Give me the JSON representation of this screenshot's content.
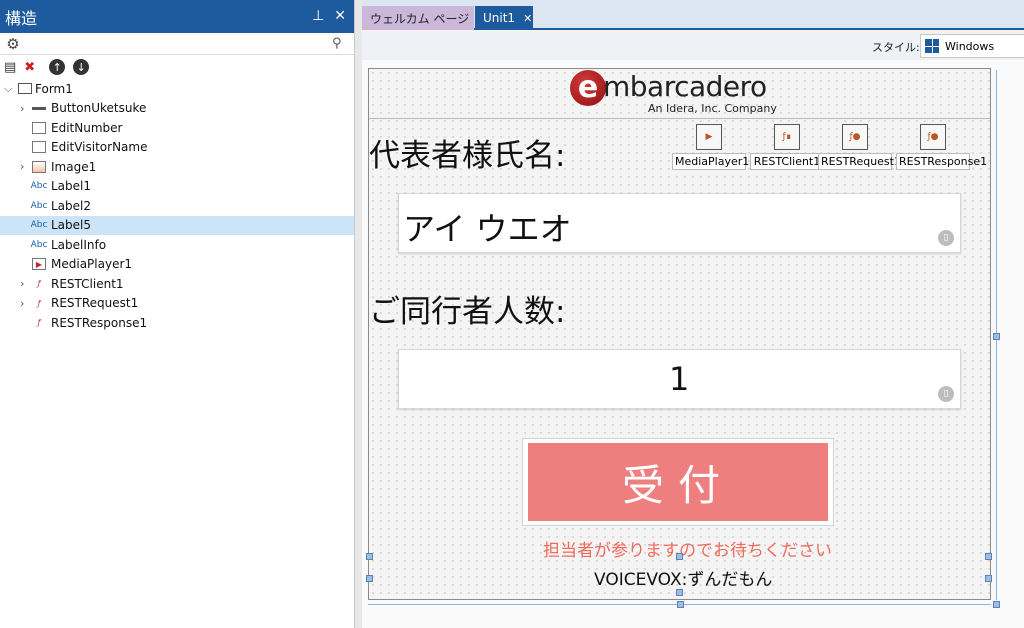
{
  "structure_panel": {
    "title": "構造",
    "pin_icon": "pin-icon",
    "close_icon": "close-icon",
    "search": {
      "value": "",
      "placeholder": ""
    },
    "tree": [
      {
        "label": "Form1",
        "level": 0,
        "expanded": true
      },
      {
        "label": "ButtonUketsuke",
        "level": 1,
        "expandable": true,
        "icon": "button-icon"
      },
      {
        "label": "EditNumber",
        "level": 1,
        "icon": "edit-icon"
      },
      {
        "label": "EditVisitorName",
        "level": 1,
        "icon": "edit-icon"
      },
      {
        "label": "Image1",
        "level": 1,
        "expandable": true,
        "icon": "image-icon"
      },
      {
        "label": "Label1",
        "level": 1,
        "icon": "label-icon"
      },
      {
        "label": "Label2",
        "level": 1,
        "icon": "label-icon"
      },
      {
        "label": "Label5",
        "level": 1,
        "icon": "label-icon",
        "selected": true
      },
      {
        "label": "LabelInfo",
        "level": 1,
        "icon": "label-icon"
      },
      {
        "label": "MediaPlayer1",
        "level": 1,
        "icon": "mediaplayer-icon"
      },
      {
        "label": "RESTClient1",
        "level": 1,
        "expandable": true,
        "icon": "rest-icon"
      },
      {
        "label": "RESTRequest1",
        "level": 1,
        "expandable": true,
        "icon": "rest-icon"
      },
      {
        "label": "RESTResponse1",
        "level": 1,
        "icon": "rest-icon"
      }
    ],
    "label_icon_text": "Abc"
  },
  "tabs": [
    {
      "label": "ウェルカム ページ",
      "active": false
    },
    {
      "label": "Unit1",
      "active": true
    }
  ],
  "style_bar": {
    "label": "スタイル:",
    "value": "Windows"
  },
  "form": {
    "logo_text": "mbarcadero",
    "logo_tagline": "An Idera, Inc. Company",
    "label_name": "代表者様氏名:",
    "edit_name_value": "アイ ウエオ",
    "label_companions": "ご同行者人数:",
    "edit_number_value": "1",
    "components": [
      "MediaPlayer1",
      "RESTClient1",
      "RESTRequest1",
      "RESTResponse1"
    ],
    "button_label": "受付",
    "info_text": "担当者が参りますのでお待ちください",
    "voicevox_text": "VOICEVOX:ずんだもん",
    "colors": {
      "button": "#ef7f7e",
      "info": "#ef6b5a",
      "header": "#1e5a9e"
    }
  }
}
